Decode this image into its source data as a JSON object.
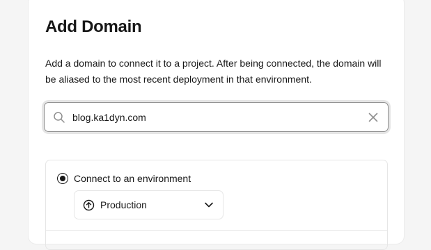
{
  "dialog": {
    "title": "Add Domain",
    "description": "Add a domain to connect it to a project. After being connected, the domain will be aliased to the most recent deployment in that environment."
  },
  "domain_input": {
    "value": "blog.ka1dyn.com",
    "icon": "search-icon",
    "clear_icon": "close-icon"
  },
  "connect": {
    "option_label": "Connect to an environment",
    "selected": true,
    "environment": {
      "value": "Production",
      "icon": "arrow-up-circle-icon"
    }
  },
  "colors": {
    "text": "#171717",
    "border": "#e6e6e6",
    "focus_ring": "#e5e5e5"
  }
}
